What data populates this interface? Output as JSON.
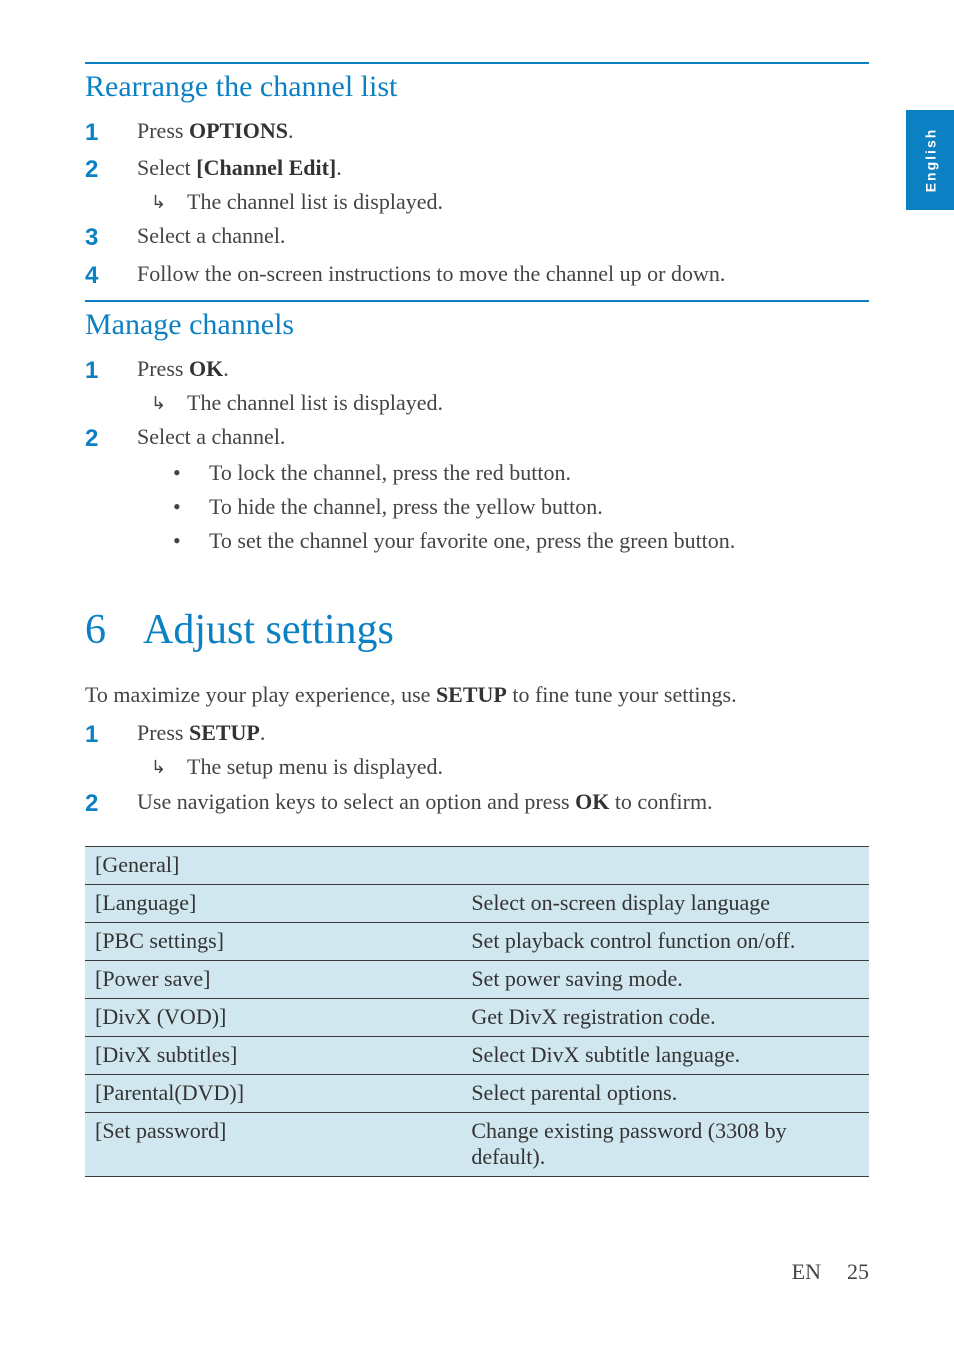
{
  "lang_tab": "English",
  "section1": {
    "title": "Rearrange the channel list",
    "steps": [
      {
        "n": "1",
        "pre": "Press ",
        "bold": "OPTIONS",
        "post": "."
      },
      {
        "n": "2",
        "pre": "Select ",
        "bold": "[Channel Edit]",
        "post": ".",
        "result": "The channel list is displayed."
      },
      {
        "n": "3",
        "text": "Select a channel."
      },
      {
        "n": "4",
        "text": "Follow the on-screen instructions to move the channel up or down."
      }
    ]
  },
  "section2": {
    "title": "Manage channels",
    "steps": [
      {
        "n": "1",
        "pre": "Press ",
        "bold": "OK",
        "post": ".",
        "result": "The channel list is displayed."
      },
      {
        "n": "2",
        "text": "Select a channel.",
        "bullets": [
          "To lock the channel, press the red button.",
          "To hide the channel, press the yellow button.",
          "To set the channel your favorite one, press the green button."
        ]
      }
    ]
  },
  "chapter": {
    "num": "6",
    "title": "Adjust settings"
  },
  "intro": {
    "pre": "To maximize your play experience, use ",
    "bold": "SETUP",
    "post": " to fine tune your settings."
  },
  "chapter_steps": [
    {
      "n": "1",
      "pre": "Press ",
      "bold": "SETUP",
      "post": ".",
      "result": "The setup menu is displayed."
    },
    {
      "n": "2",
      "pre": "Use navigation keys to select an option and press ",
      "bold": "OK",
      "post": " to confirm."
    }
  ],
  "table": {
    "rows": [
      {
        "l": "[General]",
        "r": ""
      },
      {
        "l": "[Language]",
        "r": "Select on-screen display language"
      },
      {
        "l": "[PBC settings]",
        "r": "Set playback control function on/off."
      },
      {
        "l": "[Power save]",
        "r": "Set power saving mode."
      },
      {
        "l": "[DivX (VOD)]",
        "r": "Get DivX registration code."
      },
      {
        "l": "[DivX subtitles]",
        "r": "Select DivX subtitle language."
      },
      {
        "l": "[Parental(DVD)]",
        "r": "Select parental options."
      },
      {
        "l": "[Set password]",
        "r": "Change existing password (3308 by default)."
      }
    ]
  },
  "footer": {
    "lang": "EN",
    "page": "25"
  }
}
